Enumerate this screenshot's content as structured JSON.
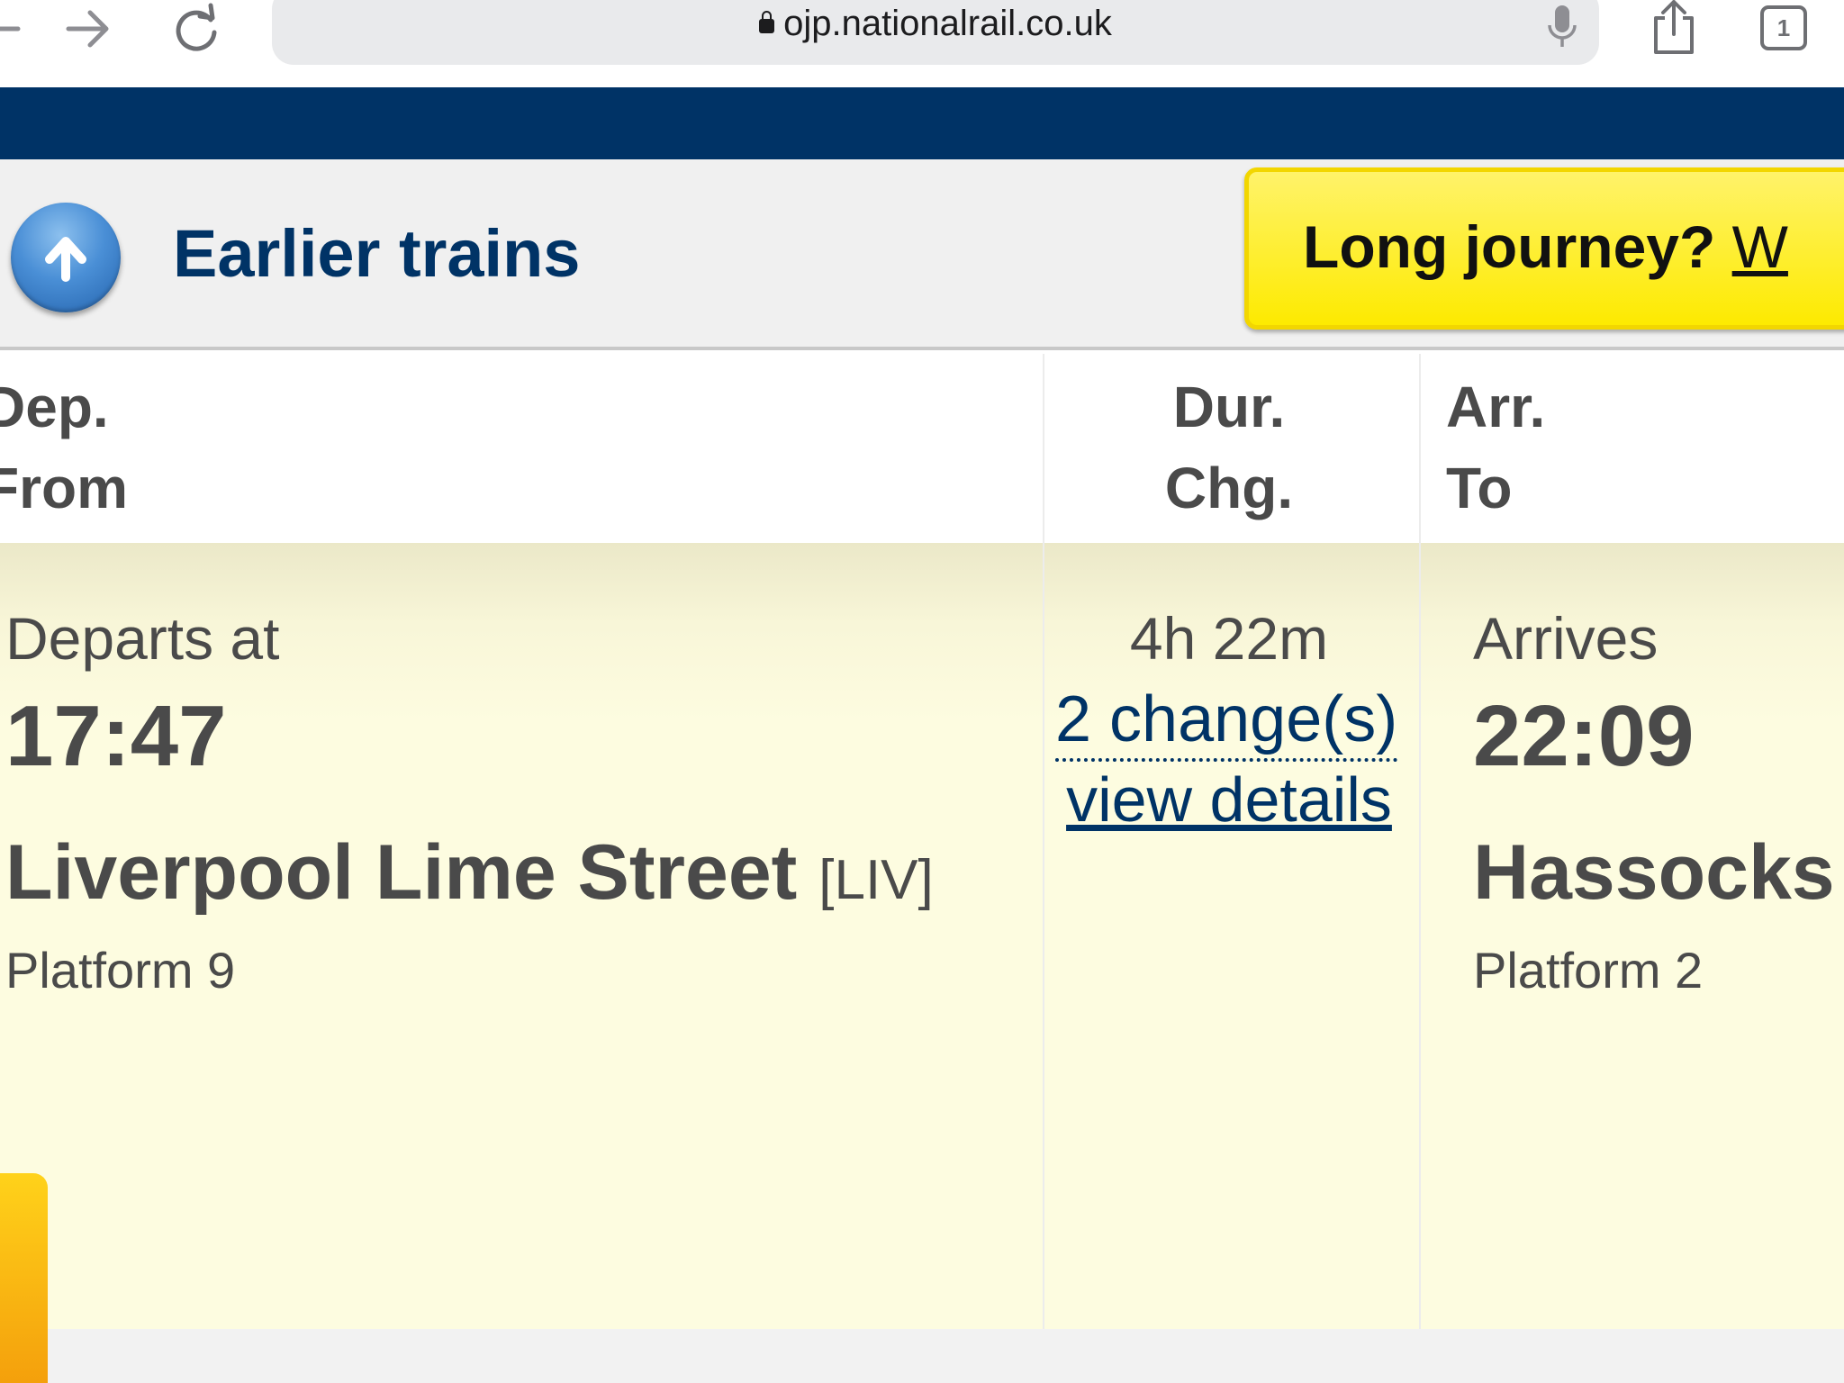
{
  "browser": {
    "url": "ojp.nationalrail.co.uk",
    "tab_count": "1",
    "icons": [
      "back-arrow-icon",
      "forward-arrow-icon",
      "reload-icon",
      "lock-icon",
      "microphone-icon",
      "share-icon",
      "tabs-icon"
    ]
  },
  "earlier": {
    "label": "Earlier trains",
    "icon": "arrow-up-icon"
  },
  "promo": {
    "text": "Long journey?",
    "link": "W"
  },
  "table_header": {
    "dep": "Dep.",
    "from": "From",
    "dur": "Dur.",
    "chg": "Chg.",
    "arr": "Arr.",
    "to": "To"
  },
  "journey": {
    "departs_label": "Departs at",
    "dep_time": "17:47",
    "origin": "Liverpool Lime Street",
    "origin_code": "[LIV]",
    "origin_platform": "Platform 9",
    "duration": "4h 22m",
    "changes": "2 change(s)",
    "details_link": "view details",
    "arrives_label": "Arrives",
    "arr_time": "22:09",
    "destination": "Hassocks",
    "dest_platform": "Platform 2"
  },
  "colors": {
    "brand_navy": "#003366",
    "row_bg": "#fdfce0",
    "promo_yellow": "#fdea00",
    "text_grey": "#4a4a4a"
  }
}
